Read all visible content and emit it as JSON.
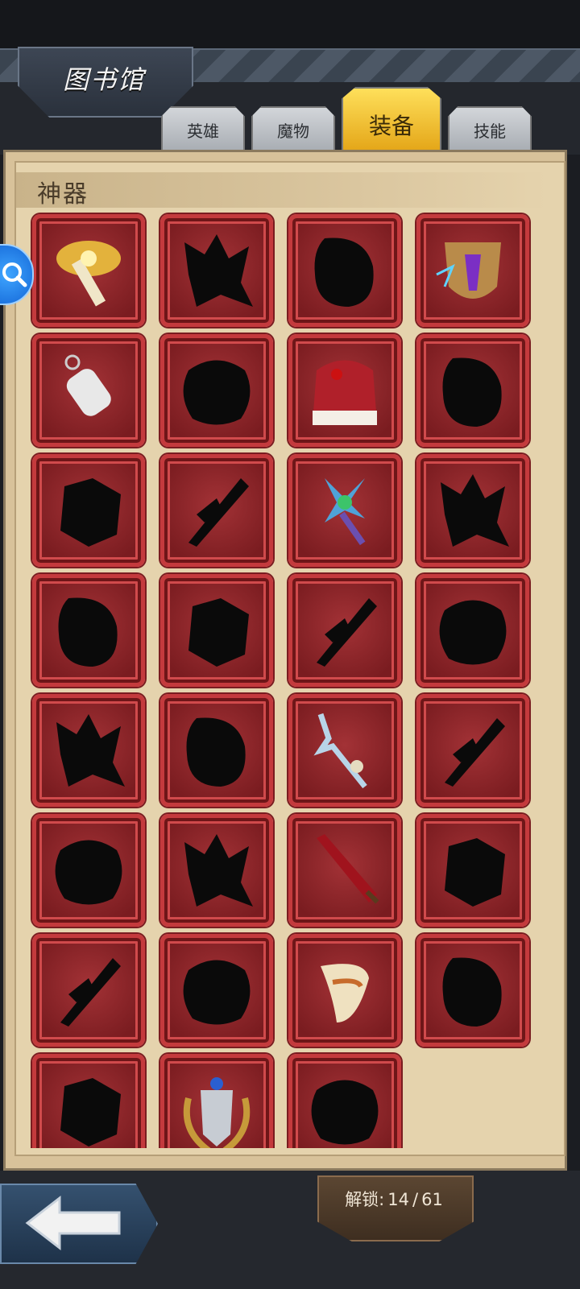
{
  "header": {
    "title": "图书馆"
  },
  "tabs": [
    {
      "label": "英雄",
      "active": false
    },
    {
      "label": "魔物",
      "active": false
    },
    {
      "label": "装备",
      "active": true
    },
    {
      "label": "技能",
      "active": false
    }
  ],
  "section": {
    "title": "神器"
  },
  "items": [
    {
      "name": "winged-scepter",
      "unlocked": true
    },
    {
      "name": "locked-item",
      "unlocked": false
    },
    {
      "name": "locked-item",
      "unlocked": false
    },
    {
      "name": "lightning-shield",
      "unlocked": true
    },
    {
      "name": "whistle",
      "unlocked": true
    },
    {
      "name": "locked-item",
      "unlocked": false
    },
    {
      "name": "fur-cloak",
      "unlocked": true
    },
    {
      "name": "locked-item",
      "unlocked": false
    },
    {
      "name": "locked-item",
      "unlocked": false
    },
    {
      "name": "locked-item",
      "unlocked": false
    },
    {
      "name": "emerald-staff",
      "unlocked": true
    },
    {
      "name": "locked-item",
      "unlocked": false
    },
    {
      "name": "locked-item",
      "unlocked": false
    },
    {
      "name": "locked-item",
      "unlocked": false
    },
    {
      "name": "locked-item",
      "unlocked": false
    },
    {
      "name": "locked-item",
      "unlocked": false
    },
    {
      "name": "locked-item",
      "unlocked": false
    },
    {
      "name": "locked-item",
      "unlocked": false
    },
    {
      "name": "bone-spear",
      "unlocked": true
    },
    {
      "name": "locked-item",
      "unlocked": false
    },
    {
      "name": "locked-item",
      "unlocked": false
    },
    {
      "name": "locked-item",
      "unlocked": false
    },
    {
      "name": "crimson-sword",
      "unlocked": true
    },
    {
      "name": "locked-item",
      "unlocked": false
    },
    {
      "name": "locked-item",
      "unlocked": false
    },
    {
      "name": "locked-item",
      "unlocked": false
    },
    {
      "name": "war-horn",
      "unlocked": true
    },
    {
      "name": "locked-item",
      "unlocked": false
    },
    {
      "name": "locked-item",
      "unlocked": false
    },
    {
      "name": "laurel-shield-emblem",
      "unlocked": true
    },
    {
      "name": "locked-item",
      "unlocked": false
    }
  ],
  "unlock": {
    "label": "解锁:",
    "current": "14",
    "separator": "/",
    "total": "61"
  },
  "icons": {
    "search": "search-icon",
    "back": "back-arrow-icon"
  },
  "colors": {
    "accent_tab": "#f3c22a",
    "cell_red": "#9a2a2e",
    "parchment": "#e5d3ad"
  }
}
